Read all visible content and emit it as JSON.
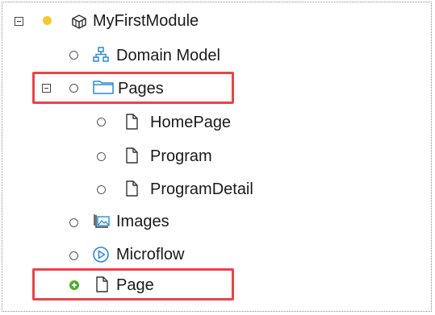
{
  "tree": {
    "module": {
      "label": "MyFirstModule",
      "status": "yellow"
    },
    "domain_model": {
      "label": "Domain Model"
    },
    "pages": {
      "label": "Pages"
    },
    "homepage": {
      "label": "HomePage"
    },
    "program": {
      "label": "Program"
    },
    "program_detail": {
      "label": "ProgramDetail"
    },
    "images": {
      "label": "Images"
    },
    "microflow": {
      "label": "Microflow"
    },
    "new_page": {
      "label": "Page"
    }
  },
  "colors": {
    "highlight": "#e8444a",
    "module_status": "#f5c830",
    "add_status": "#4caf2a",
    "folder": "#2a8bd6",
    "microflow": "#2a8bd6"
  },
  "icons": {
    "module": "module-icon",
    "domain_model": "domain-model-icon",
    "pages": "folder-icon",
    "page": "page-icon",
    "images": "images-icon",
    "microflow": "microflow-icon",
    "add": "add-icon"
  }
}
